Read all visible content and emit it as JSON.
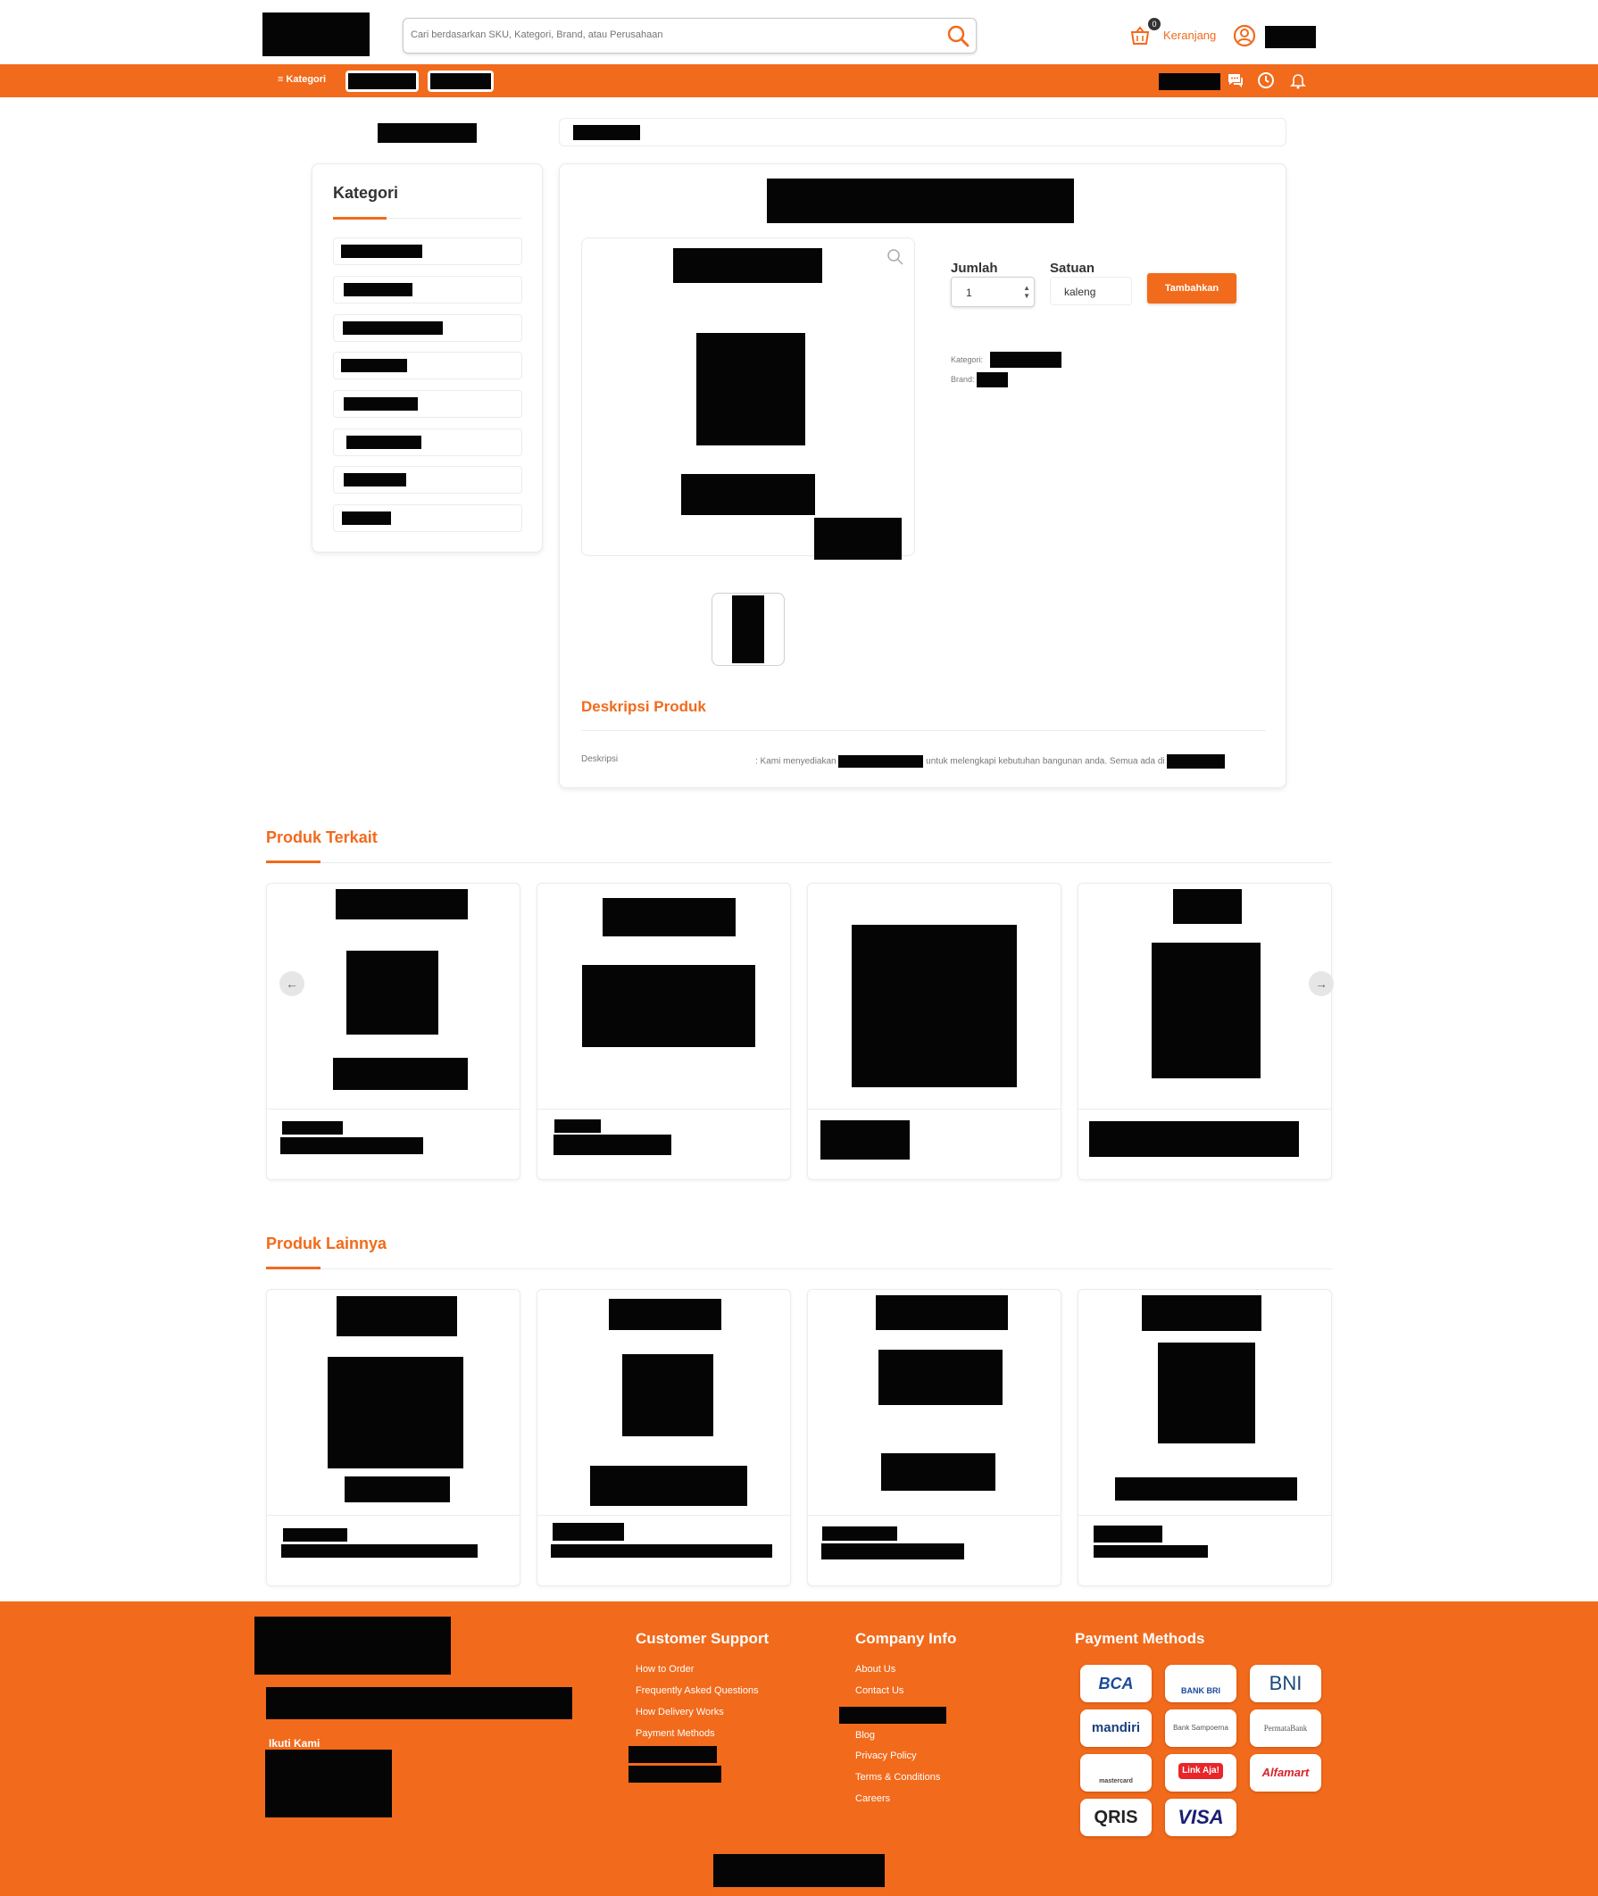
{
  "header": {
    "search_placeholder": "Cari berdasarkan SKU, Kategori, Brand, atau Perusahaan",
    "cart_count": "0",
    "cart_label": "Keranjang"
  },
  "navbar": {
    "kategori_label": "≡ Kategori"
  },
  "sidebar": {
    "title": "Kategori"
  },
  "product": {
    "qty_label": "Jumlah",
    "qty_value": "1",
    "unit_label": "Satuan",
    "unit_value": "kaleng",
    "add_button": "Tambahkan",
    "kategori_label": "Kategori:",
    "brand_label": "Brand:",
    "desc_title": "Deskripsi Produk",
    "desc_label": "Deskripsi",
    "desc_prefix": ": Kami menyediakan",
    "desc_middle": "untuk melengkapi kebutuhan bangunan anda. Semua ada di"
  },
  "related": {
    "title": "Produk Terkait",
    "prev_arrow": "←",
    "next_arrow": "→"
  },
  "others": {
    "title": "Produk Lainnya"
  },
  "footer": {
    "follow_label": "Ikuti Kami",
    "support_title": "Customer Support",
    "support_links": [
      "How to Order",
      "Frequently Asked Questions",
      "How Delivery Works",
      "Payment Methods"
    ],
    "company_title": "Company Info",
    "company_links_top": [
      "About Us",
      "Contact Us"
    ],
    "company_links_bottom": [
      "Blog",
      "Privacy Policy",
      "Terms & Conditions",
      "Careers"
    ],
    "payment_title": "Payment Methods",
    "payments": [
      "BCA",
      "BANK BRI",
      "BNI",
      "mandiri",
      "Bank Sampoerna",
      "PermataBank",
      "mastercard",
      "Link Aja!",
      "Alfamart",
      "QRIS",
      "VISA"
    ]
  },
  "colors": {
    "brand_orange": "#f26a1b"
  },
  "icons": [
    "search-icon",
    "cart-icon",
    "user-icon",
    "chat-icon",
    "clock-icon",
    "bell-icon",
    "zoom-icon"
  ]
}
